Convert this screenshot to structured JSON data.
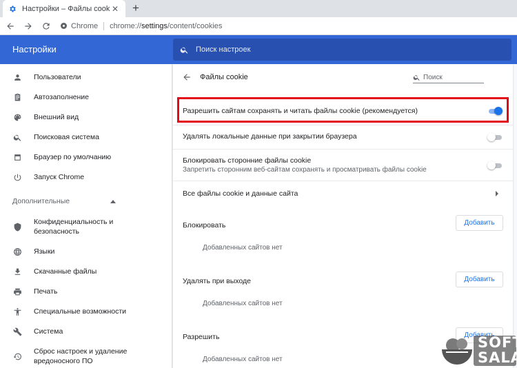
{
  "tab": {
    "title": "Настройки – Файлы cookie",
    "favicon": "gear-icon"
  },
  "toolbar": {
    "site_chip": "Chrome",
    "url_scheme": "chrome://",
    "url_host": "settings",
    "url_path": "/content/cookies"
  },
  "header": {
    "title": "Настройки",
    "search_placeholder": "Поиск настроек",
    "color": "#3367d6"
  },
  "sidebar": {
    "items": [
      {
        "label": "Пользователи",
        "icon": "person-icon"
      },
      {
        "label": "Автозаполнение",
        "icon": "clipboard-icon"
      },
      {
        "label": "Внешний вид",
        "icon": "palette-icon"
      },
      {
        "label": "Поисковая система",
        "icon": "search-icon"
      },
      {
        "label": "Браузер по умолчанию",
        "icon": "browser-icon"
      },
      {
        "label": "Запуск Chrome",
        "icon": "power-icon"
      }
    ],
    "advanced_label": "Дополнительные",
    "advanced_items": [
      {
        "label": "Конфиденциальность и",
        "label2": "безопасность",
        "icon": "shield-icon"
      },
      {
        "label": "Языки",
        "icon": "globe-icon"
      },
      {
        "label": "Скачанные файлы",
        "icon": "download-icon"
      },
      {
        "label": "Печать",
        "icon": "printer-icon"
      },
      {
        "label": "Специальные возможности",
        "icon": "accessibility-icon"
      },
      {
        "label": "Система",
        "icon": "wrench-icon"
      },
      {
        "label": "Сброс настроек и удаление",
        "label2": "вредоносного ПО",
        "icon": "reset-icon"
      }
    ]
  },
  "page": {
    "title": "Файлы cookie",
    "search_placeholder": "Поиск",
    "settings": [
      {
        "label": "Разрешить сайтам сохранять и читать файлы cookie (рекомендуется)",
        "enabled": true
      },
      {
        "label": "Удалять локальные данные при закрытии браузера",
        "enabled": false
      },
      {
        "label": "Блокировать сторонние файлы cookie",
        "sublabel": "Запретить сторонним веб-сайтам сохранять и просматривать файлы cookie",
        "enabled": false
      }
    ],
    "all_cookies_label": "Все файлы cookie и данные сайта",
    "sections": [
      {
        "title": "Блокировать",
        "button": "Добавить",
        "empty": "Добавленных сайтов нет"
      },
      {
        "title": "Удалять при выходе",
        "button": "Добавить",
        "empty": "Добавленных сайтов нет"
      },
      {
        "title": "Разрешить",
        "button": "Добавить",
        "empty": "Добавленных сайтов нет"
      }
    ]
  },
  "watermark": {
    "line1": "SOFT",
    "line2": "SALAD"
  },
  "colors": {
    "accent": "#1a73e8",
    "highlight": "#e30a17"
  }
}
